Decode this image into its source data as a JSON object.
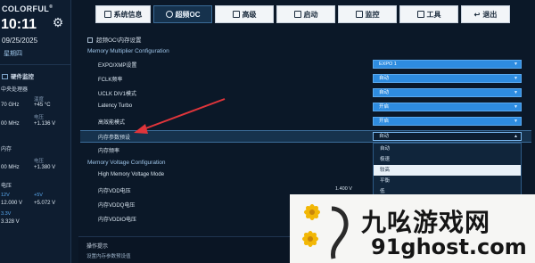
{
  "sidebar": {
    "brand": "COLORFUL",
    "brand_mark": "®",
    "time": "10:11",
    "date": "09/25/2025",
    "weekday": "星期四",
    "hw_monitor": "硬件监控",
    "cpu_section": "中央处理器",
    "cpu_col2_label": "温度",
    "cpu_freq": "70 GHz",
    "cpu_temp": "+45 °C",
    "cpu_col2b_label": "电压",
    "cpu_bclk": "00 MHz",
    "cpu_volt": "+1.136 V",
    "mem_section": "内存",
    "mem_col2_label": "电压",
    "mem_freq": "00 MHz",
    "mem_volt": "+1.380 V",
    "volt_section": "电压",
    "v12_label": "12V",
    "v5_label": "+5V",
    "v12_value": "12.000 V",
    "v5_value": "+5.072 V",
    "v33_label": "3.3V",
    "v33_value": "3.328 V"
  },
  "tabs": [
    {
      "label": "系统信息",
      "icon": "grid-icon"
    },
    {
      "label": "超频OC",
      "icon": "gauge-icon",
      "active": true
    },
    {
      "label": "高级",
      "icon": "sliders-icon"
    },
    {
      "label": "启动",
      "icon": "power-icon"
    },
    {
      "label": "监控",
      "icon": "monitor-icon"
    },
    {
      "label": "工具",
      "icon": "tools-icon"
    },
    {
      "label": "退出",
      "icon": "back-arrow-icon"
    }
  ],
  "main": {
    "breadcrumb": "超频OC\\内存设置",
    "section_multiplier": "Memory Multiplier Configuration",
    "rows": [
      {
        "label": "EXPO/XMP设置",
        "value": "EXPO 1"
      },
      {
        "label": "FCLK频率",
        "value": "自动"
      },
      {
        "label": "UCLK DIV1模式",
        "value": "自动"
      },
      {
        "label": "Latency Turbo",
        "value": "开启"
      },
      {
        "label": "高效能模式",
        "value": "开启"
      },
      {
        "label": "内存参数预设",
        "value": "自动"
      },
      {
        "label": "内存频率",
        "value": ""
      }
    ],
    "dropdown_options": [
      "自动",
      "极速",
      "较高",
      "平衡",
      "低"
    ],
    "dropdown_highlighted": "较高",
    "section_voltage": "Memory Voltage Configuration",
    "voltage_rows": [
      {
        "label": "High Memory Voltage Mode",
        "value": ""
      },
      {
        "label": "内存VDD电压",
        "value": "1.400 V"
      },
      {
        "label": "内存VDDQ电压",
        "value": ""
      },
      {
        "label": "内存VDDIO电压",
        "value": ""
      }
    ],
    "help_title": "操作提示",
    "help_text": "设置内存参数预设值"
  },
  "watermark": {
    "cn": "九吆游戏网",
    "url": "91ghost.com"
  },
  "colors": {
    "accent": "#2e8ce0",
    "arrow": "#e0353b",
    "background": "#0b1828"
  }
}
